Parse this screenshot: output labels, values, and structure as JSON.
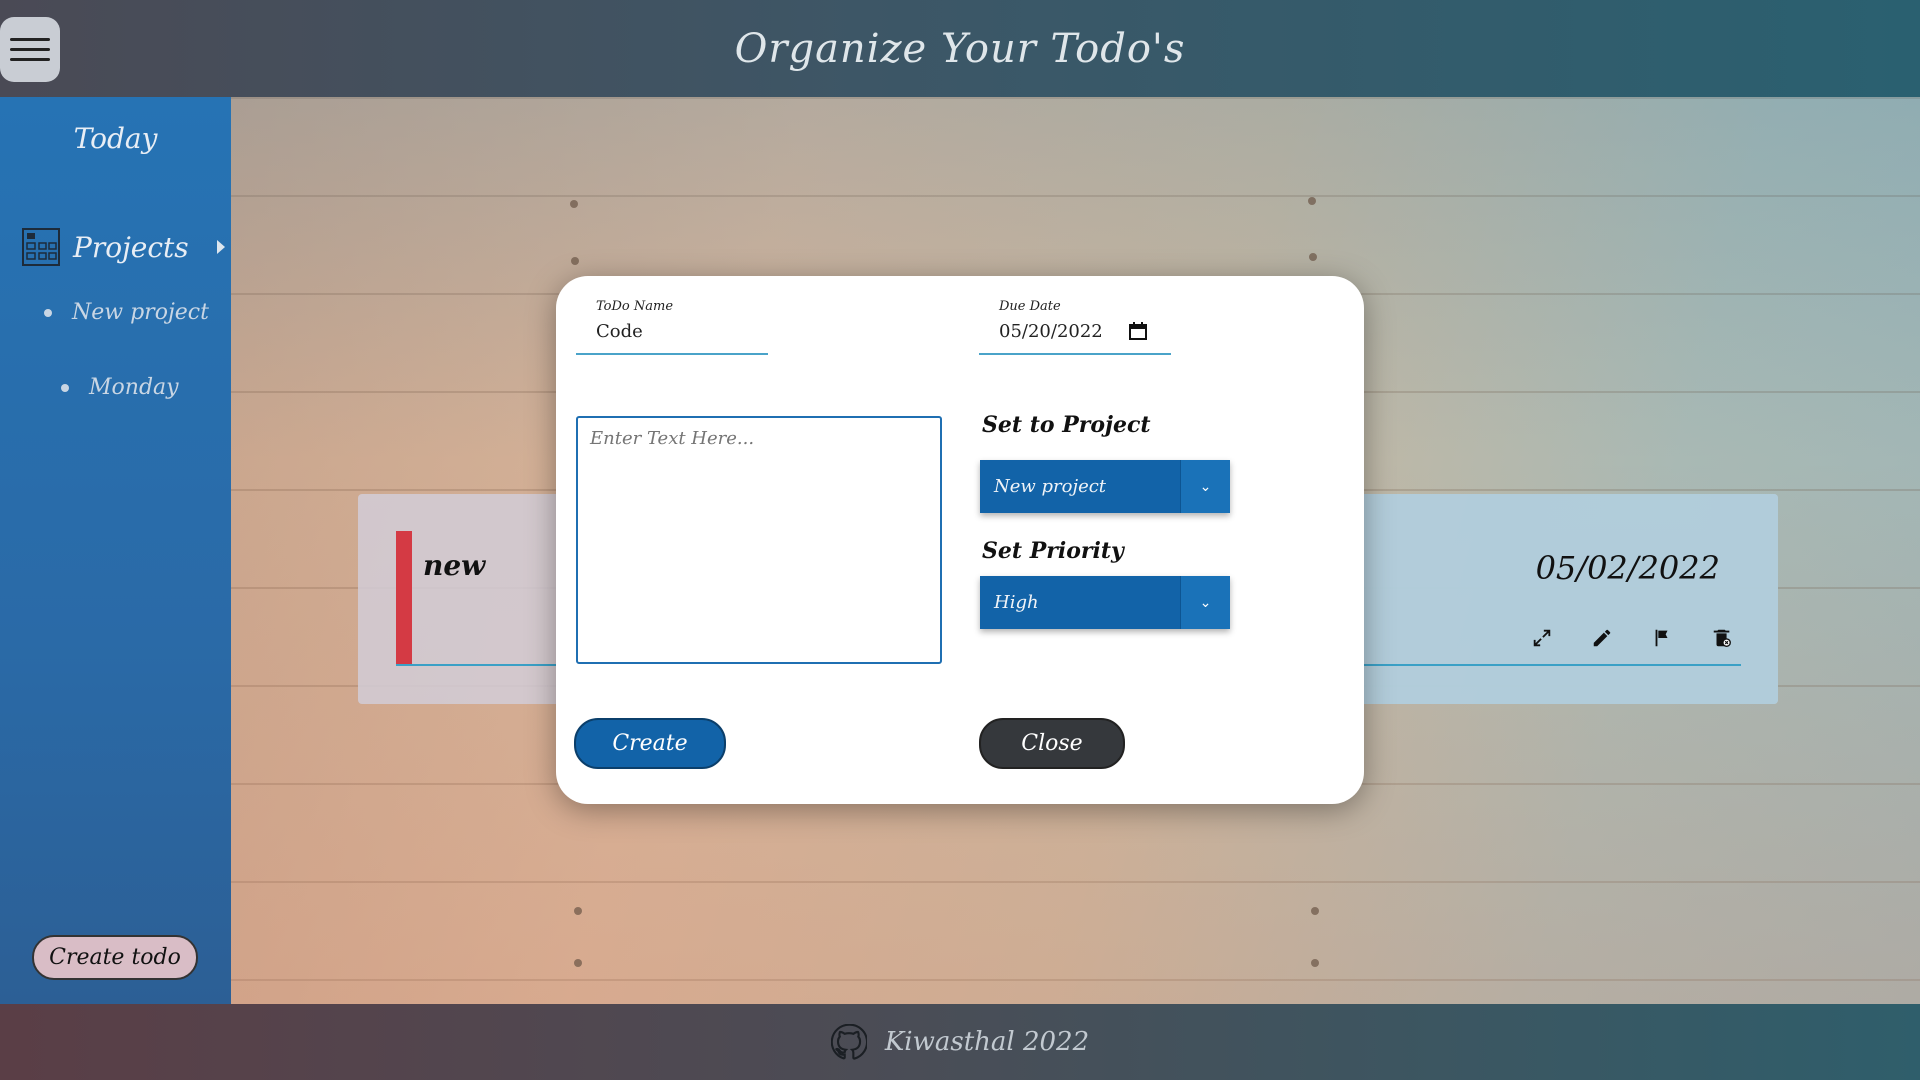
{
  "header": {
    "title": "Organize Your Todo's",
    "menu_icon": "hamburger-menu-icon"
  },
  "sidebar": {
    "today_label": "Today",
    "projects_label": "Projects",
    "projects": [
      {
        "label": "New project"
      },
      {
        "label": "Monday"
      }
    ],
    "create_todo_label": "Create todo"
  },
  "todo_card": {
    "name": "new",
    "date": "05/02/2022",
    "priority_color": "#d43a44",
    "actions": [
      "expand-icon",
      "edit-icon",
      "flag-icon",
      "delete-icon"
    ]
  },
  "modal": {
    "name_label": "ToDo Name",
    "name_value": "Code",
    "due_label": "Due Date",
    "due_value": "05/20/2022",
    "description_placeholder": "Enter Text Here...",
    "project_label": "Set to Project",
    "project_selected": "New project",
    "priority_label": "Set Priority",
    "priority_selected": "High",
    "create_label": "Create",
    "close_label": "Close"
  },
  "footer": {
    "text": "Kiwasthal 2022"
  },
  "colors": {
    "primary": "#1263a8",
    "sidebar": "#2a6aa7",
    "priority_high": "#d43a44"
  }
}
